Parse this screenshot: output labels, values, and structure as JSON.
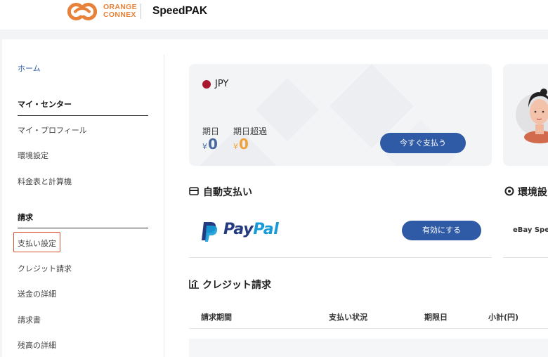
{
  "header": {
    "logo_line1": "ORANGE",
    "logo_line2": "CONNEX",
    "brand": "SpeedPAK"
  },
  "sidebar": {
    "home": "ホーム",
    "section_my_center": "マイ・センター",
    "my_profile": "マイ・プロフィール",
    "env_settings": "環境設定",
    "rate_calculator": "料金表と計算機",
    "section_billing": "請求",
    "payment_settings": "支払い設定",
    "credit_billing": "クレジット請求",
    "remittance_details": "送金の詳細",
    "invoices": "請求書",
    "balance_details": "残高の詳細"
  },
  "balance": {
    "currency": "JPY",
    "due_label": "期日",
    "overdue_label": "期日超過",
    "currency_symbol": "¥",
    "due_amount": "0",
    "overdue_amount": "0",
    "pay_now_label": "今すぐ支払う"
  },
  "auto_payment": {
    "title": "自動支払い",
    "paypal_pay": "Pay",
    "paypal_pal": "Pal",
    "enable_label": "有効にする"
  },
  "env_section": {
    "title": "環境設",
    "ebay_label": "eBay Spe"
  },
  "credit_billing": {
    "title": "クレジット請求",
    "columns": [
      "請求期間",
      "支払い状況",
      "期限日",
      "小計(円)"
    ]
  },
  "colors": {
    "primary": "#2f5aa6",
    "accent_orange": "#e8823a",
    "overdue": "#f0a33a",
    "highlight": "#d9542f"
  }
}
